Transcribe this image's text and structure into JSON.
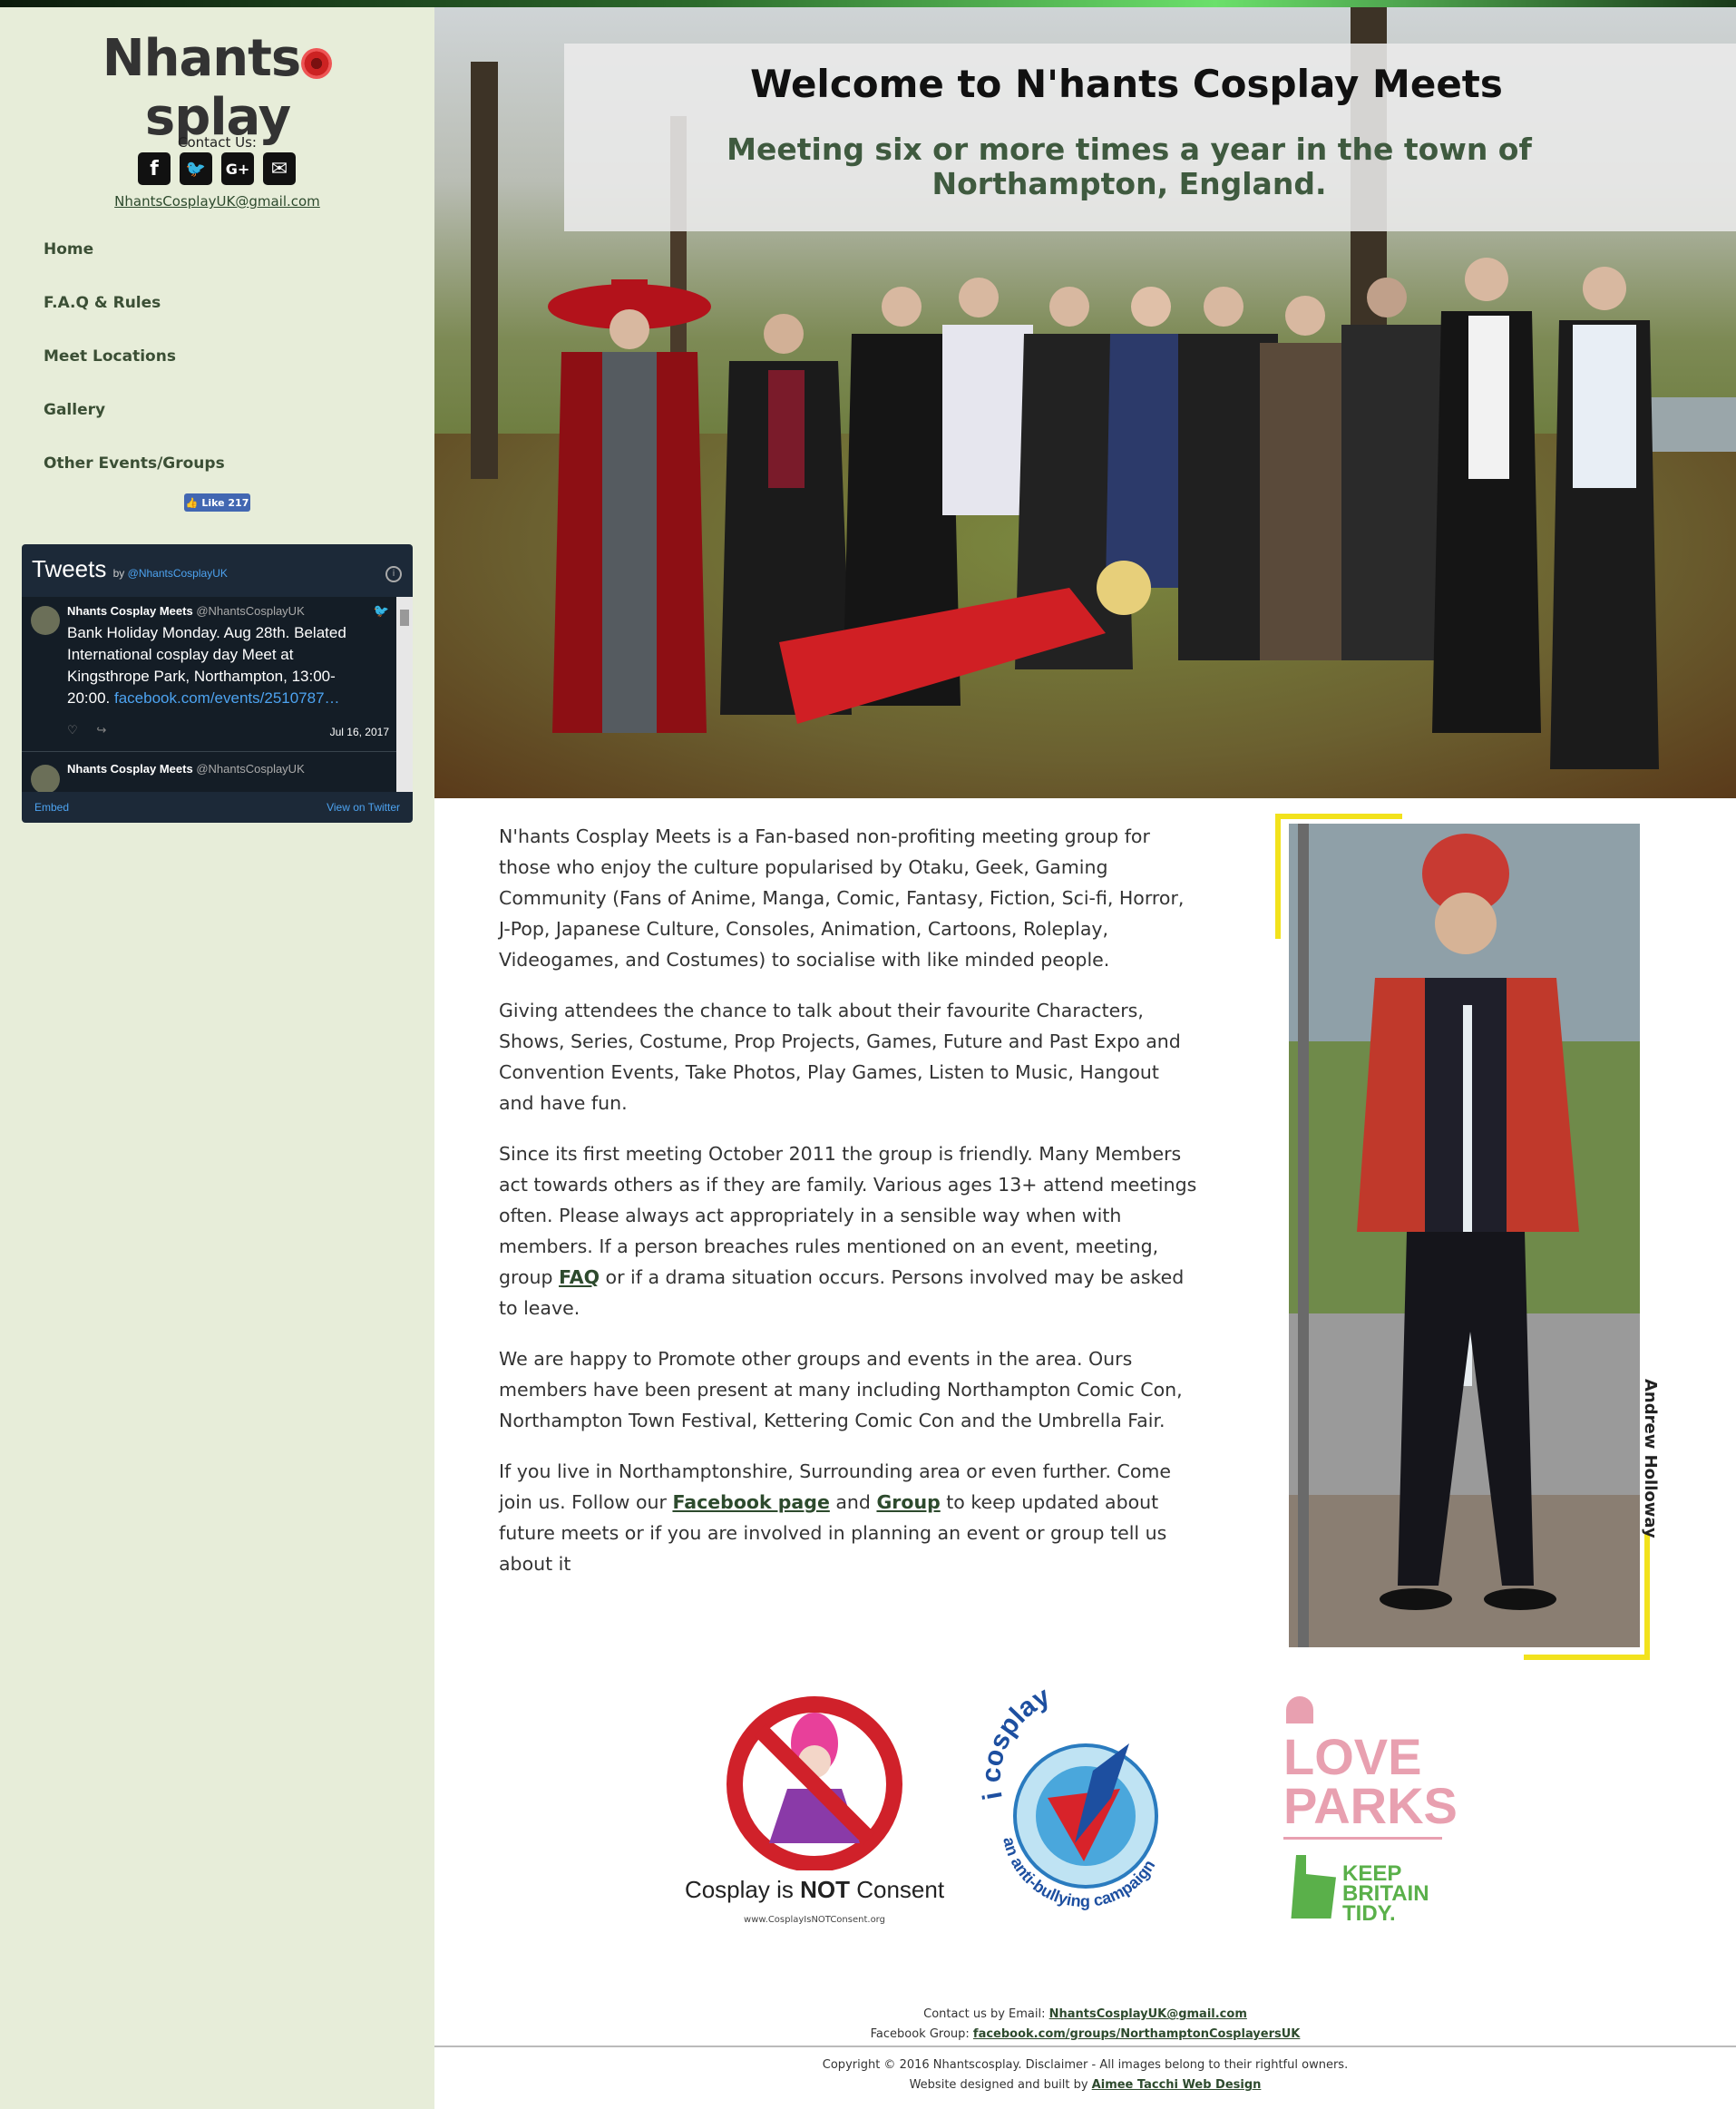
{
  "brand": {
    "logo_prefix": "Nhants",
    "logo_suffix": "splay"
  },
  "contact": {
    "label": "Contact Us:",
    "email": "NhantsCosplayUK@gmail.com",
    "social": [
      {
        "icon": "facebook-icon",
        "glyph": "f"
      },
      {
        "icon": "twitter-icon",
        "glyph": "🐦"
      },
      {
        "icon": "google-plus-icon",
        "glyph": "G+"
      },
      {
        "icon": "email-icon",
        "glyph": "✉"
      }
    ]
  },
  "nav": [
    {
      "label": "Home"
    },
    {
      "label": "F.A.Q & Rules"
    },
    {
      "label": "Meet Locations"
    },
    {
      "label": "Gallery"
    },
    {
      "label": "Other Events/Groups"
    }
  ],
  "fb_like": {
    "label": "Like 217"
  },
  "tweets": {
    "title": "Tweets",
    "by": "by",
    "handle_link": "@NhantsCosplayUK",
    "tweet1": {
      "name": "Nhants Cosplay Meets",
      "handle": "@NhantsCosplayUK",
      "text": "Bank Holiday Monday. Aug 28th. Belated International cosplay day Meet at Kingsthrope Park, Northampton, 13:00-20:00.",
      "link": "facebook.com/events/2510787…",
      "date": "Jul 16, 2017"
    },
    "tweet2": {
      "name": "Nhants Cosplay Meets",
      "handle": "@NhantsCosplayUK"
    },
    "embed": "Embed",
    "view_on_twitter": "View on Twitter"
  },
  "hero": {
    "title": "Welcome to N'hants Cosplay Meets",
    "subtitle": "Meeting six or more times a year in the town of Northampton, England."
  },
  "content": {
    "p1": "N'hants Cosplay Meets is a Fan-based non-profiting meeting group for those who enjoy the culture popularised by Otaku, Geek, Gaming Community (Fans of Anime, Manga, Comic, Fantasy, Fiction, Sci-fi, Horror, J-Pop, Japanese Culture, Consoles, Animation, Cartoons, Roleplay, Videogames, and Costumes) to socialise with like minded people.",
    "p2": "Giving attendees the chance to talk about their favourite Characters, Shows, Series, Costume, Prop Projects, Games, Future and Past Expo and Convention Events, Take Photos, Play Games, Listen to Music, Hangout and have fun.",
    "p3_a": "Since its first meeting October 2011 the group is friendly. Many Members act towards others as if they are family. Various ages 13+ attend meetings often. Please always act appropriately in a sensible way when with members. If a person breaches rules mentioned on an event, meeting, group ",
    "p3_link": "FAQ",
    "p3_b": " or if a drama situation occurs. Persons involved may be asked to leave.",
    "p4": "We are happy to Promote other groups and events in the area. Ours members have been present at many including Northampton Comic Con, Northampton Town Festival, Kettering Comic Con and the Umbrella Fair.",
    "p5_a": "If you live in Northamptonshire, Surrounding area or even further. Come join us. Follow our ",
    "p5_link1": "Facebook page",
    "p5_mid": " and ",
    "p5_link2": "Group",
    "p5_b": " to keep updated about future meets or if you are involved in planning an event or group tell us about it"
  },
  "photo_caption": "Andrew Holloway",
  "badges": {
    "cnc_title_a": "Cosplay is ",
    "cnc_title_b": "NOT",
    "cnc_title_c": " Consent",
    "cnc_url": "www.CosplayIsNOTConsent.org",
    "icosplay_top": "i cosplay",
    "icosplay_bottom": "an anti-bullying campaign",
    "love": "LOVE",
    "parks": "PARKS",
    "keep": "KEEP",
    "britain": "BRITAIN",
    "tidy": "TIDY."
  },
  "footer": {
    "email_label": "Contact us by Email: ",
    "email": "NhantsCosplayUK@gmail.com",
    "fb_label": "Facebook Group: ",
    "fb_link": "facebook.com/groups/NorthamptonCosplayersUK",
    "copyright": "Copyright © 2016 Nhantscosplay. Disclaimer - All images belong to their rightful owners.",
    "designed_label": "Website designed and built by ",
    "designer": "Aimee Tacchi Web Design"
  },
  "colors": {
    "sidebar_bg": "#e7edd9",
    "link_green": "#2d4a2d",
    "accent_yellow": "#f2e21c",
    "tweet_bg": "#1c2938"
  }
}
